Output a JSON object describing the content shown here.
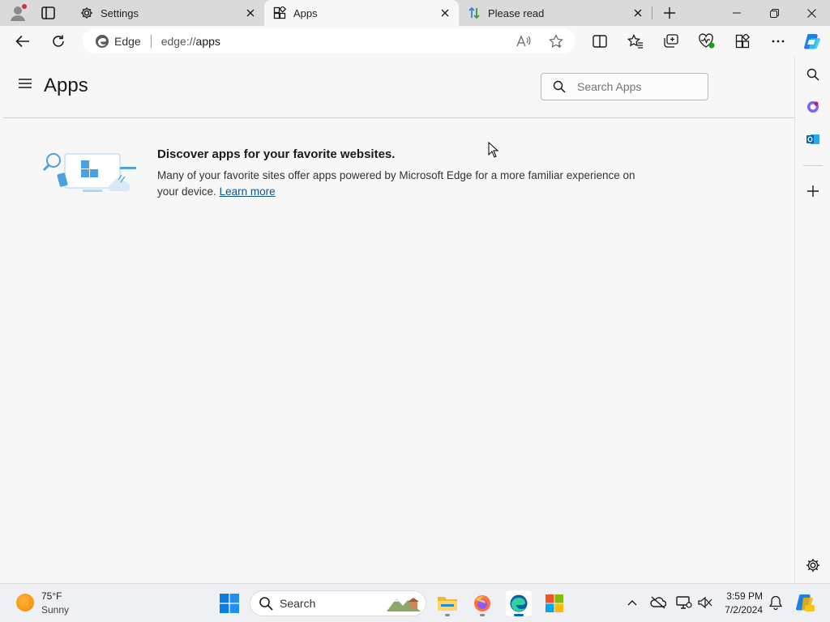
{
  "tabs": [
    {
      "label": "Settings",
      "icon": "gear-icon",
      "active": false
    },
    {
      "label": "Apps",
      "icon": "apps-icon",
      "active": true
    },
    {
      "label": "Please read",
      "icon": "sort-arrows-icon",
      "active": false
    }
  ],
  "address_bar": {
    "site_label": "Edge",
    "url_prefix": "edge://",
    "url_path": "apps"
  },
  "page": {
    "title": "Apps",
    "search_placeholder": "Search Apps",
    "promo": {
      "heading": "Discover apps for your favorite websites.",
      "body": "Many of your favorite sites offer apps powered by Microsoft Edge for a more familiar experience on your device.",
      "link": "Learn more"
    }
  },
  "taskbar": {
    "weather_temp": "75°F",
    "weather_condition": "Sunny",
    "search_label": "Search",
    "time": "3:59 PM",
    "date": "7/2/2024"
  },
  "colors": {
    "accent": "#0067c0",
    "link": "#0f548c",
    "tabstrip": "#dadada",
    "page_bg": "#f7f7f7"
  }
}
